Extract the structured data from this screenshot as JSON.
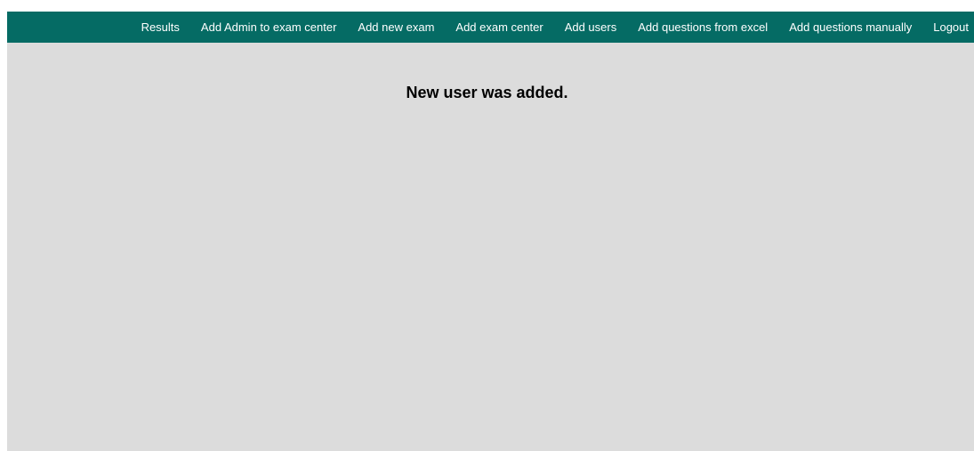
{
  "nav": {
    "items": [
      {
        "label": "Results"
      },
      {
        "label": "Add Admin to exam center"
      },
      {
        "label": "Add new exam"
      },
      {
        "label": "Add exam center"
      },
      {
        "label": "Add users"
      },
      {
        "label": "Add questions from excel"
      },
      {
        "label": "Add questions manually"
      },
      {
        "label": "Logout"
      }
    ]
  },
  "main": {
    "message": "New user was added."
  },
  "colors": {
    "navbar_bg": "#056b64",
    "page_bg": "#dcdcdc",
    "nav_text": "#ffffff"
  }
}
